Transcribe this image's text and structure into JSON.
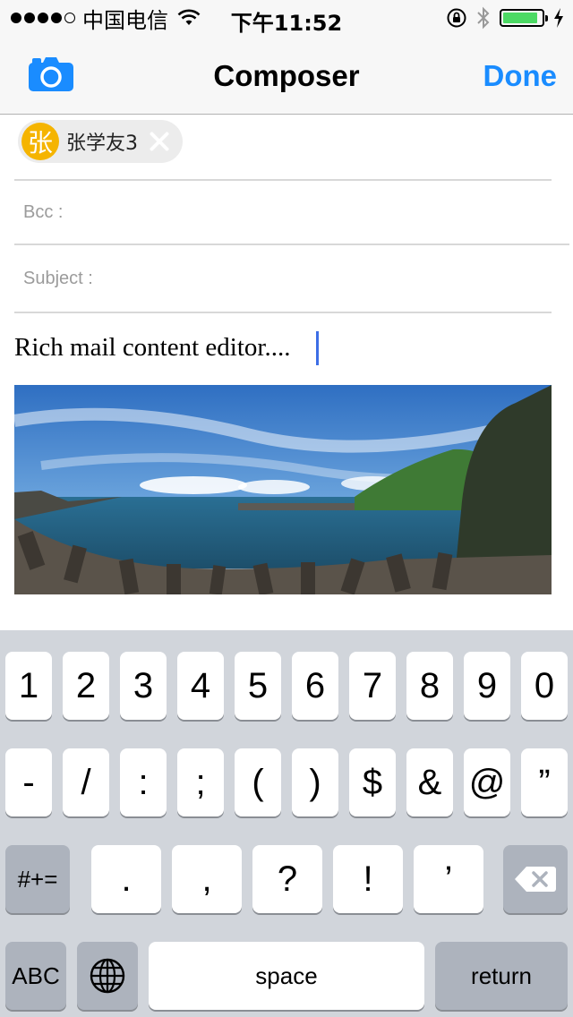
{
  "status_bar": {
    "carrier": "中国电信",
    "time": "下午11:52",
    "signal_dots_filled": 4,
    "signal_dots_total": 5,
    "battery_level": 0.9
  },
  "nav": {
    "title": "Composer",
    "done_label": "Done",
    "camera_icon": "camera-icon"
  },
  "fields": {
    "recipient": {
      "avatar_char": "张",
      "name": "张学友3"
    },
    "bcc_label": "Bcc :",
    "subject_label": "Subject :"
  },
  "body": {
    "text": "Rich mail content editor...."
  },
  "colors": {
    "accent": "#1a8cff",
    "avatar": "#f5b400",
    "battery": "#4cd964",
    "keyboard_bg": "#d1d5db",
    "key_dark": "#adb3bd"
  },
  "keyboard": {
    "row1": [
      "1",
      "2",
      "3",
      "4",
      "5",
      "6",
      "7",
      "8",
      "9",
      "0"
    ],
    "row2": [
      "-",
      "/",
      ":",
      ";",
      "(",
      ")",
      "$",
      "&",
      "@",
      "”"
    ],
    "row3_left": "#+=",
    "row3": [
      ".",
      ",",
      "?",
      "!",
      "’"
    ],
    "row3_right_icon": "backspace-icon",
    "abc_label": "ABC",
    "globe_icon": "globe-icon",
    "space_label": "space",
    "return_label": "return"
  }
}
